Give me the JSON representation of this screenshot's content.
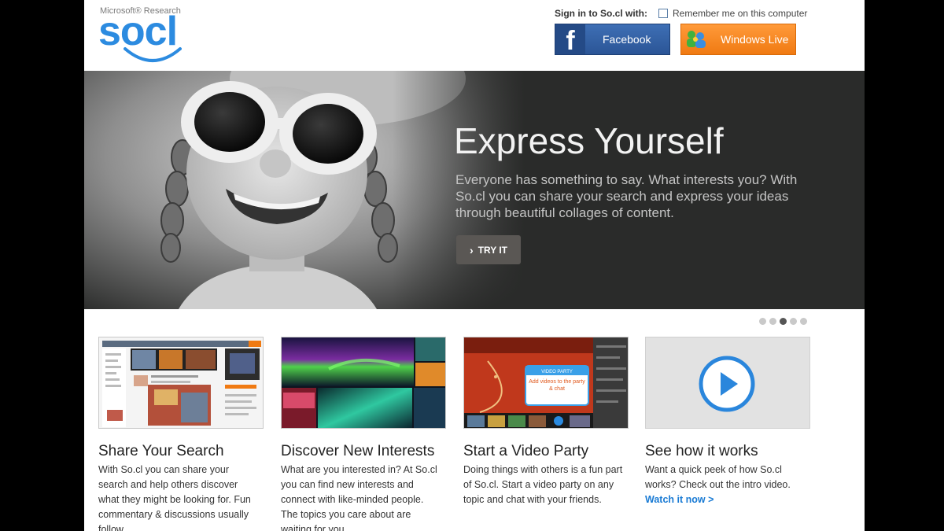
{
  "header": {
    "logo_top": "Microsoft® Research",
    "logo_word": "socl",
    "signin_label": "Sign in to So.cl with:",
    "remember_label": "Remember me on this computer",
    "facebook_label": "Facebook",
    "windows_live_label": "Windows Live"
  },
  "hero": {
    "title": "Express Yourself",
    "text": "Everyone has something to say. What interests you? With So.cl you can share your search and express your ideas through beautiful collages of content.",
    "button_label": "TRY IT"
  },
  "carousel": {
    "slide_count": 5,
    "active_index": 2
  },
  "video_thumb": {
    "title": "VIDEO PARTY",
    "bubble": "Add videos to the party & chat"
  },
  "features": [
    {
      "title": "Share Your Search",
      "text": "With So.cl you can share your search and help others discover what they might be looking for. Fun commentary & discussions usually follow."
    },
    {
      "title": "Discover New Interests",
      "text": "What are you interested in? At So.cl you can find new interests and connect with like-minded people. The topics you care about are waiting for you."
    },
    {
      "title": "Start a Video Party",
      "text": "Doing things with others is a fun part of So.cl. Start a video party on any topic and chat with your friends."
    },
    {
      "title": "See how it works",
      "text": "Want a quick peek of how So.cl works? Check out the intro video.",
      "link": "Watch it now >"
    }
  ],
  "colors": {
    "brand_blue": "#2c8be0",
    "facebook": "#2b5596",
    "windows_live": "#f07a12",
    "hero_bg": "#2a2b2a",
    "link": "#1a7bd4"
  }
}
